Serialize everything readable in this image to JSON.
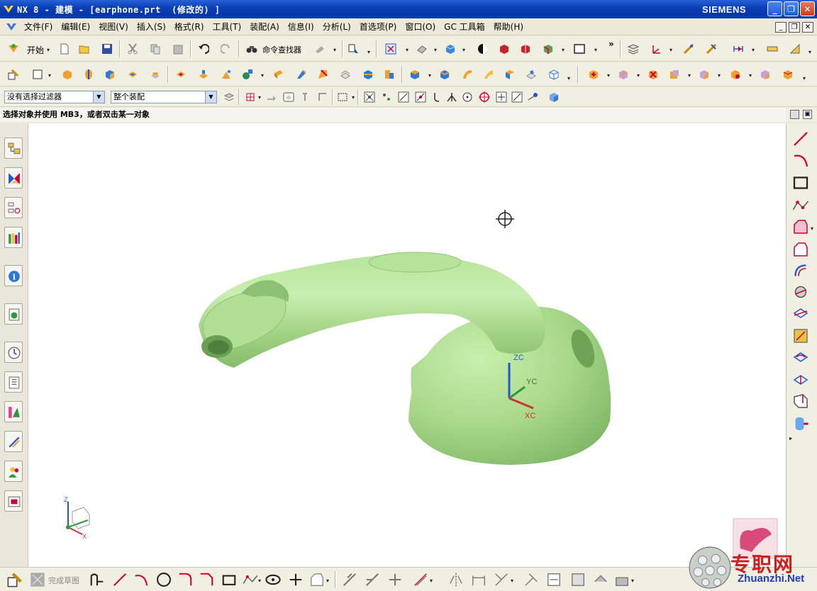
{
  "window": {
    "title": "NX 8 - 建模 - [earphone.prt  (修改的) ]",
    "brand": "SIEMENS",
    "minimize": "_",
    "restore": "❐",
    "close": "✕"
  },
  "menu": {
    "items": [
      {
        "label": "文件(F)"
      },
      {
        "label": "编辑(E)"
      },
      {
        "label": "视图(V)"
      },
      {
        "label": "插入(S)"
      },
      {
        "label": "格式(R)"
      },
      {
        "label": "工具(T)"
      },
      {
        "label": "装配(A)"
      },
      {
        "label": "信息(I)"
      },
      {
        "label": "分析(L)"
      },
      {
        "label": "首选项(P)"
      },
      {
        "label": "窗口(O)"
      },
      {
        "label": "GC 工具箱"
      },
      {
        "label": "帮助(H)"
      }
    ]
  },
  "toolbar": {
    "start_label": "开始",
    "command_finder_label": "命令查找器"
  },
  "selection": {
    "filter_value": "没有选择过滤器",
    "scope_value": "整个装配"
  },
  "cue_line": "选择对象并使用 MB3，或者双击某一对象",
  "viewport": {
    "model_color": "#a9d88a",
    "triad": {
      "z": "ZC",
      "y": "YC",
      "x": "XC"
    },
    "mini_triad": {
      "z": "Z",
      "x": "X"
    }
  },
  "sketch_toolbar": {
    "finish_label": "完成草图"
  },
  "watermark": {
    "text": "专职网",
    "url": "Zhuanzhi.Net"
  }
}
